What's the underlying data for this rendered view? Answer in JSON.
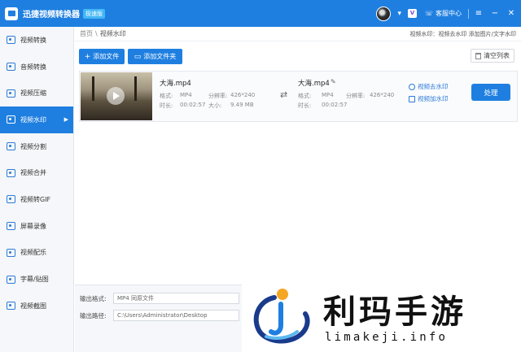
{
  "app": {
    "name": "迅捷视频转换器",
    "edition": "极速版",
    "help_label": "客服中心",
    "vip_icon": "vip-icon",
    "colors": {
      "primary": "#1f7fe0",
      "edition_badge": "#43b7f5"
    }
  },
  "sidebar": {
    "items": [
      {
        "label": "视频转换",
        "icon": "video-convert-icon"
      },
      {
        "label": "音频转换",
        "icon": "audio-convert-icon"
      },
      {
        "label": "视频压缩",
        "icon": "video-compress-icon"
      },
      {
        "label": "视频水印",
        "icon": "video-watermark-icon",
        "active": true
      },
      {
        "label": "视频分割",
        "icon": "video-split-icon"
      },
      {
        "label": "视频合并",
        "icon": "video-merge-icon"
      },
      {
        "label": "视频转GIF",
        "icon": "video-gif-icon"
      },
      {
        "label": "屏幕录像",
        "icon": "screen-record-icon"
      },
      {
        "label": "视频配乐",
        "icon": "video-music-icon"
      },
      {
        "label": "字幕/贴图",
        "icon": "subtitle-icon"
      },
      {
        "label": "视频截图",
        "icon": "video-screenshot-icon"
      }
    ]
  },
  "breadcrumb": {
    "home": "首页",
    "sep": "\\",
    "current": "视频水印",
    "hint": "视频水印：视频去水印 添加图片/文字水印"
  },
  "toolbar": {
    "add_file": "添加文件",
    "add_folder": "添加文件夹",
    "clear_list": "清空列表"
  },
  "file": {
    "source": {
      "name": "大海.mp4",
      "format_label": "格式:",
      "format": "MP4",
      "resolution_label": "分辨率:",
      "resolution": "426*240",
      "duration_label": "时长:",
      "duration": "00:02:57",
      "size_label": "大小:",
      "size": "9.49 MB"
    },
    "output": {
      "name": "大海.mp4",
      "format_label": "格式:",
      "format": "MP4",
      "resolution_label": "分辨率:",
      "resolution": "426*240",
      "duration_label": "时长:",
      "duration": "00:02:57"
    },
    "remove_watermark": "视频去水印",
    "add_watermark": "视频加水印",
    "process": "处理"
  },
  "output": {
    "format_label": "输出格式:",
    "format_value": "MP4  同原文件",
    "path_label": "输出路径:",
    "path_value": "C:\\Users\\Administrator\\Desktop"
  },
  "watermark": {
    "title": "利玛手游",
    "url": "limakeji.info"
  }
}
